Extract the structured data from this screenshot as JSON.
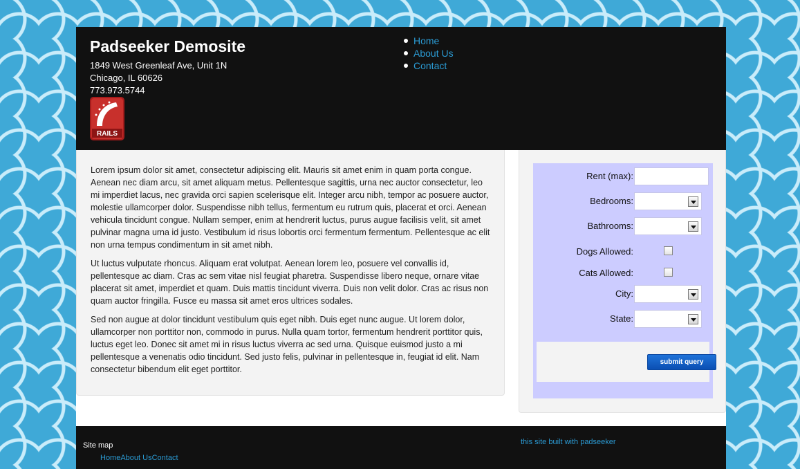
{
  "header": {
    "site_title": "Padseeker Demosite",
    "address_line1": "1849 West Greenleaf Ave, Unit 1N",
    "address_line2": "Chicago, IL 60626",
    "phone": "773.973.5744",
    "logo_text": "RAILS",
    "logo_icon": "rails-logo-icon"
  },
  "nav": {
    "items": [
      {
        "label": "Home"
      },
      {
        "label": "About Us"
      },
      {
        "label": "Contact"
      }
    ]
  },
  "content": {
    "paragraphs": [
      "Lorem ipsum dolor sit amet, consectetur adipiscing elit. Mauris sit amet enim in quam porta congue. Aenean nec diam arcu, sit amet aliquam metus. Pellentesque sagittis, urna nec auctor consectetur, leo mi imperdiet lacus, nec gravida orci sapien scelerisque elit. Integer arcu nibh, tempor ac posuere auctor, molestie ullamcorper dolor. Suspendisse nibh tellus, fermentum eu rutrum quis, placerat et orci. Aenean vehicula tincidunt congue. Nullam semper, enim at hendrerit luctus, purus augue facilisis velit, sit amet pulvinar magna urna id justo. Vestibulum id risus lobortis orci fermentum fermentum. Pellentesque ac elit non urna tempus condimentum in sit amet nibh.",
      "Ut luctus vulputate rhoncus. Aliquam erat volutpat. Aenean lorem leo, posuere vel convallis id, pellentesque ac diam. Cras ac sem vitae nisl feugiat pharetra. Suspendisse libero neque, ornare vitae placerat sit amet, imperdiet et quam. Duis mattis tincidunt viverra. Duis non velit dolor. Cras ac risus non quam auctor fringilla. Fusce eu massa sit amet eros ultrices sodales.",
      "Sed non augue at dolor tincidunt vestibulum quis eget nibh. Duis eget nunc augue. Ut lorem dolor, ullamcorper non porttitor non, commodo in purus. Nulla quam tortor, fermentum hendrerit porttitor quis, luctus eget leo. Donec sit amet mi in risus luctus viverra ac sed urna. Quisque euismod justo a mi pellentesque a venenatis odio tincidunt. Sed justo felis, pulvinar in pellentesque in, feugiat id elit. Nam consectetur bibendum elit eget porttitor."
    ]
  },
  "search": {
    "rent_label": "Rent (max):",
    "rent_value": "",
    "bedrooms_label": "Bedrooms:",
    "bedrooms_value": "",
    "bathrooms_label": "Bathrooms:",
    "bathrooms_value": "",
    "dogs_label": "Dogs Allowed:",
    "dogs_checked": false,
    "cats_label": "Cats Allowed:",
    "cats_checked": false,
    "city_label": "City:",
    "city_value": "",
    "state_label": "State:",
    "state_value": "",
    "submit_label": "submit query"
  },
  "footer": {
    "sitemap_title": "Site map",
    "links": [
      {
        "label": "Home"
      },
      {
        "label": "About Us"
      },
      {
        "label": "Contact"
      }
    ],
    "credit": "this site built with padseeker"
  },
  "colors": {
    "background": "#3fa9d7",
    "header_bg": "#111111",
    "link": "#2b9bd4",
    "search_panel": "#ccccff",
    "button": "#1565d0"
  }
}
